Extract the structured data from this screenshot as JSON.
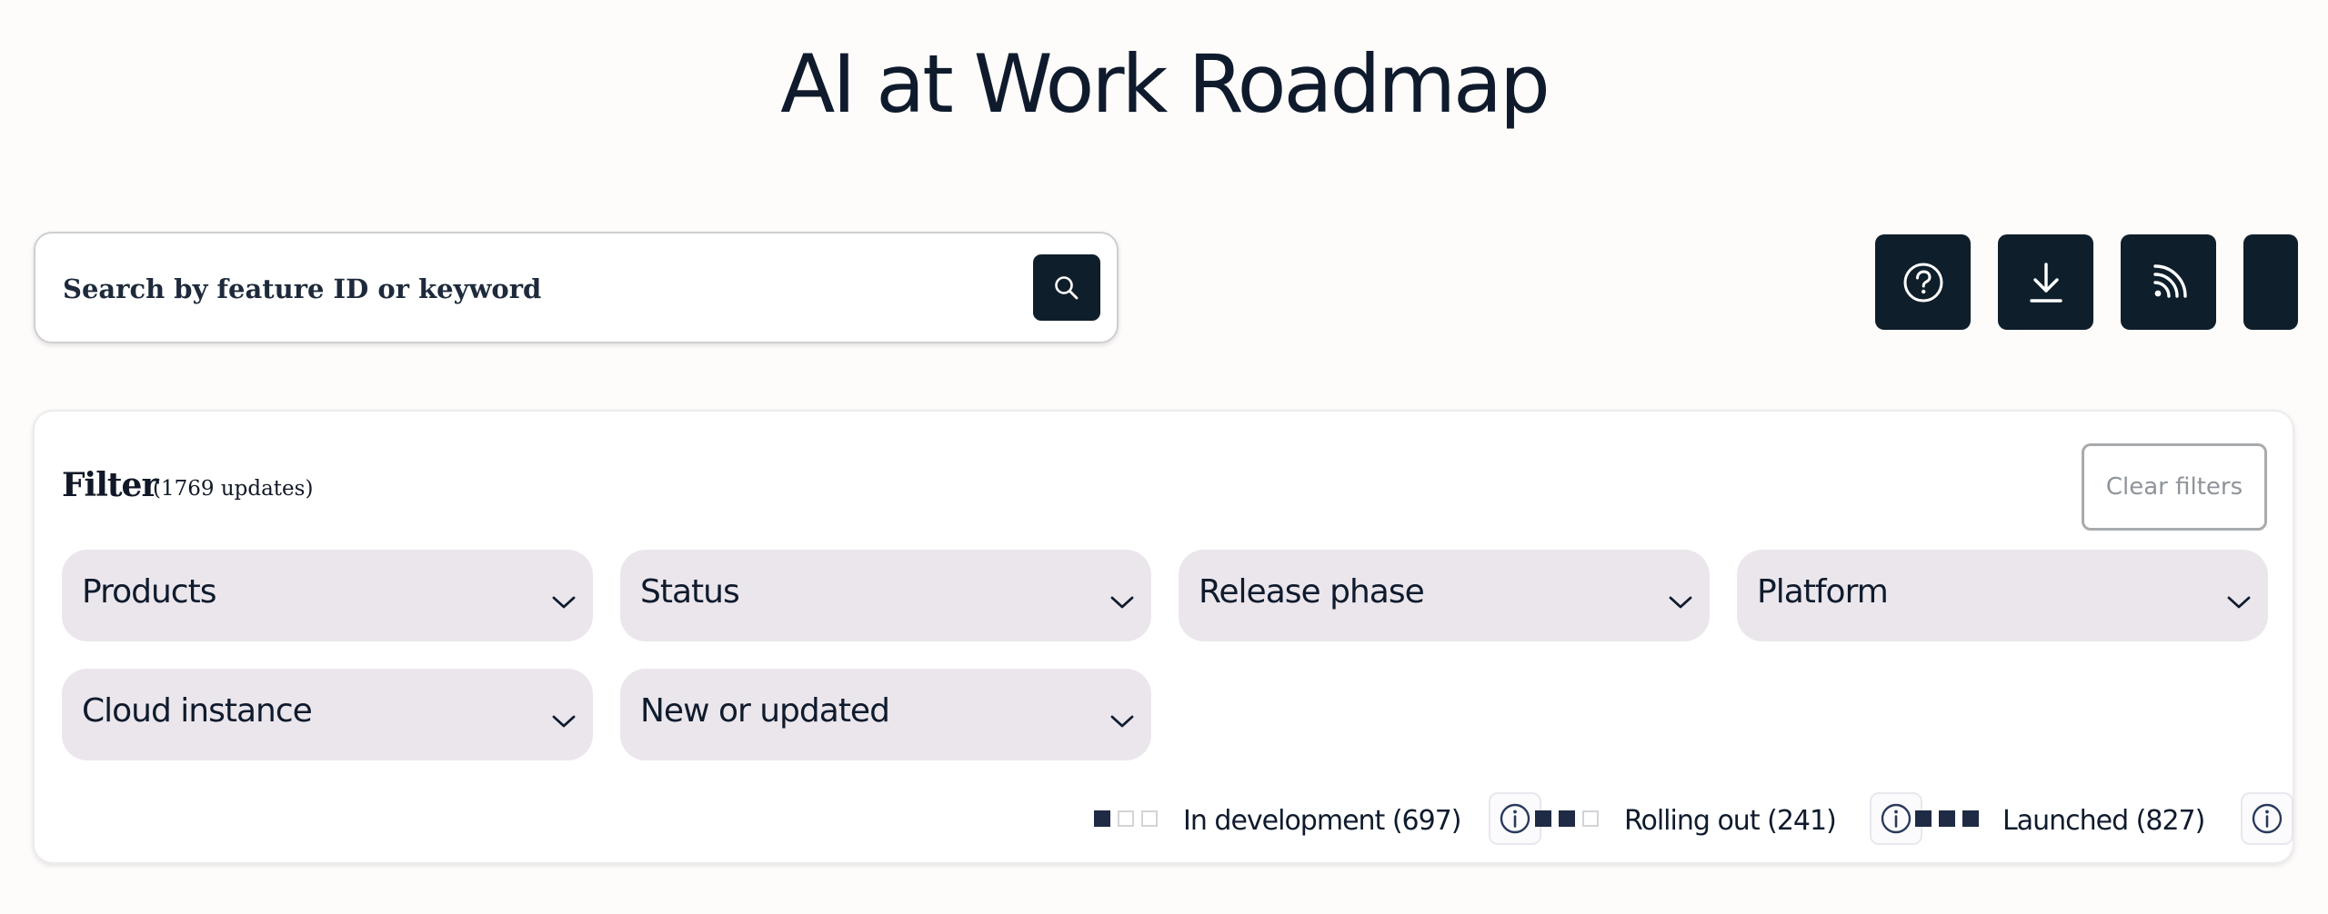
{
  "header": {
    "title": "AI at Work Roadmap"
  },
  "search": {
    "placeholder": "Search by feature ID or keyword",
    "icon": "magnifier-icon"
  },
  "toolbar": {
    "buttons": [
      {
        "icon": "help-circle-icon"
      },
      {
        "icon": "download-icon"
      },
      {
        "icon": "rss-feed-icon"
      },
      {
        "icon": "more-icon"
      }
    ]
  },
  "filter": {
    "heading": "Filter",
    "count": "(1769 updates)",
    "clear_label": "Clear filters",
    "dropdowns": [
      {
        "label": "Products"
      },
      {
        "label": "Status"
      },
      {
        "label": "Release phase"
      },
      {
        "label": "Platform"
      },
      {
        "label": "Cloud instance"
      },
      {
        "label": "New or updated"
      }
    ],
    "legend": [
      {
        "label": "In development (697)",
        "filled": 1,
        "total": 3
      },
      {
        "label": "Rolling out (241)",
        "filled": 2,
        "total": 3
      },
      {
        "label": "Launched (827)",
        "filled": 3,
        "total": 3
      }
    ]
  },
  "colors": {
    "background": "#fefcfb",
    "dark_button": "#0f1e2b",
    "dropdown_bg": "#ebe6ec",
    "text": "#0f1b2d"
  }
}
